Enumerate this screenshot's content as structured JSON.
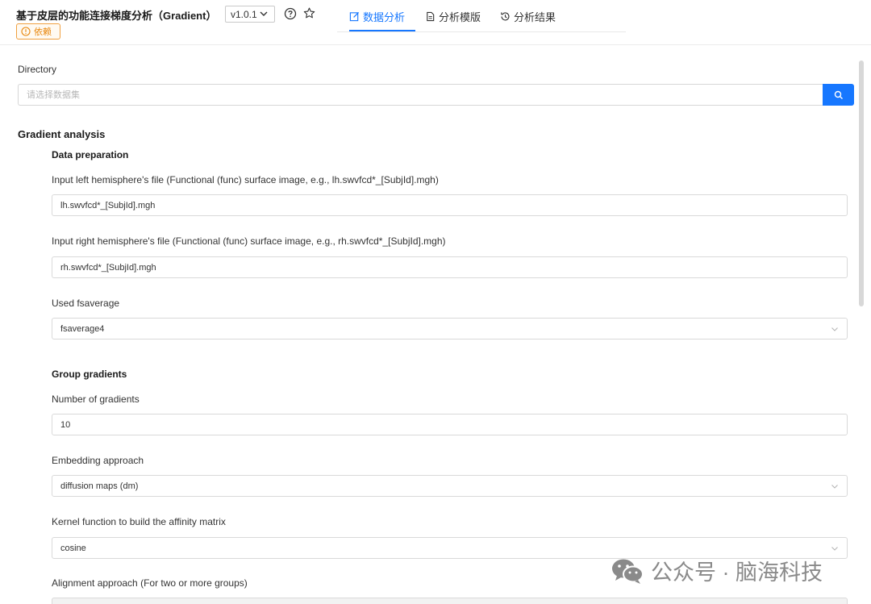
{
  "header": {
    "title": "基于皮层的功能连接梯度分析（Gradient）",
    "version": "v1.0.1",
    "dependency_badge": "依赖",
    "tabs": [
      {
        "label": "数据分析",
        "icon": "edit-icon",
        "active": true
      },
      {
        "label": "分析模版",
        "icon": "file-icon",
        "active": false
      },
      {
        "label": "分析结果",
        "icon": "history-icon",
        "active": false
      }
    ]
  },
  "directory": {
    "label": "Directory",
    "placeholder": "请选择数据集"
  },
  "gradient_analysis": {
    "title": "Gradient analysis",
    "data_preparation": {
      "title": "Data preparation",
      "left_label": "Input left hemisphere's file (Functional (func) surface image, e.g., lh.swvfcd*_[SubjId].mgh)",
      "left_value": "lh.swvfcd*_[SubjId].mgh",
      "right_label": "Input right hemisphere's file (Functional (func) surface image, e.g., rh.swvfcd*_[SubjId].mgh)",
      "right_value": "rh.swvfcd*_[SubjId].mgh",
      "fsaverage_label": "Used fsaverage",
      "fsaverage_value": "fsaverage4"
    },
    "group_gradients": {
      "title": "Group gradients",
      "num_label": "Number of gradients",
      "num_value": "10",
      "embedding_label": "Embedding approach",
      "embedding_value": "diffusion maps (dm)",
      "kernel_label": "Kernel function to build the affinity matrix",
      "kernel_value": "cosine",
      "alignment_label": "Alignment approach (For two or more groups)"
    }
  },
  "watermark": {
    "text": "公众号 · 脑海科技"
  },
  "colors": {
    "accent": "#1677ff",
    "warning": "#e8850a"
  }
}
